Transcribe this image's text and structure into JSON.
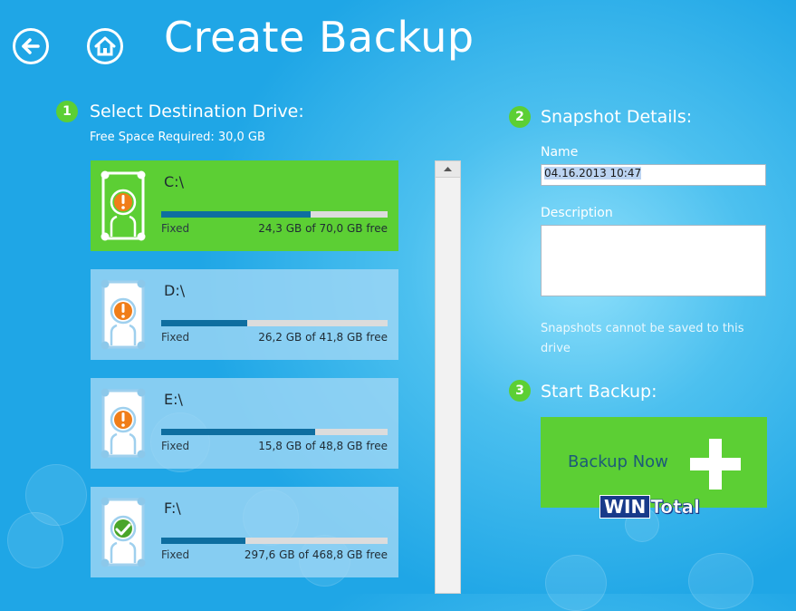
{
  "header": {
    "title": "Create Backup"
  },
  "step1": {
    "number": "1",
    "label": "Select Destination Drive:",
    "free_space_required": "Free Space Required: 30,0 GB"
  },
  "drives": [
    {
      "name": "C:\\",
      "type": "Fixed",
      "free_text": "24,3 GB of 70,0 GB free",
      "used_fraction": 0.66,
      "status": "warning",
      "selected": true
    },
    {
      "name": "D:\\",
      "type": "Fixed",
      "free_text": "26,2 GB of 41,8 GB free",
      "used_fraction": 0.38,
      "status": "warning",
      "selected": false
    },
    {
      "name": "E:\\",
      "type": "Fixed",
      "free_text": "15,8 GB of 48,8 GB free",
      "used_fraction": 0.68,
      "status": "warning",
      "selected": false
    },
    {
      "name": "F:\\",
      "type": "Fixed",
      "free_text": "297,6 GB of 468,8 GB free",
      "used_fraction": 0.37,
      "status": "ok",
      "selected": false
    }
  ],
  "step2": {
    "number": "2",
    "label": "Snapshot Details:",
    "name_label": "Name",
    "name_value": "04.16.2013 10:47",
    "description_label": "Description",
    "description_value": "",
    "warning": "Snapshots cannot be saved to this drive"
  },
  "step3": {
    "number": "3",
    "label": "Start Backup:",
    "button_label": "Backup Now"
  },
  "watermark": {
    "part1": "WIN",
    "part2": "Total"
  },
  "colors": {
    "accent_green": "#5ccf34",
    "progress_fill": "#0e6ea0",
    "warning_orange": "#f07d18",
    "ok_green": "#4aa52a"
  }
}
